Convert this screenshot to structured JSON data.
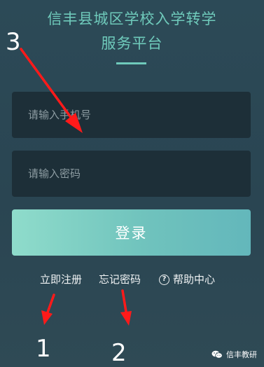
{
  "header": {
    "title_line1": "信丰县城区学校入学转学",
    "title_line2": "服务平台"
  },
  "form": {
    "phone_placeholder": "请输入手机号",
    "password_placeholder": "请输入密码",
    "login_label": "登录"
  },
  "links": {
    "register": "立即注册",
    "forgot_password": "忘记密码",
    "help": "帮助中心",
    "help_icon": "question-circle-icon"
  },
  "annotations": {
    "label_1": "1",
    "label_2": "2",
    "label_3": "3",
    "arrow_color": "#ff1a1a"
  },
  "watermark": {
    "text": "信丰教研",
    "icon": "wechat-icon"
  },
  "colors": {
    "background": "#2c4a57",
    "accent": "#6fcabb",
    "field_background": "#1d2f38",
    "button_gradient_start": "#8fdccb",
    "button_gradient_end": "#63b7bb"
  }
}
